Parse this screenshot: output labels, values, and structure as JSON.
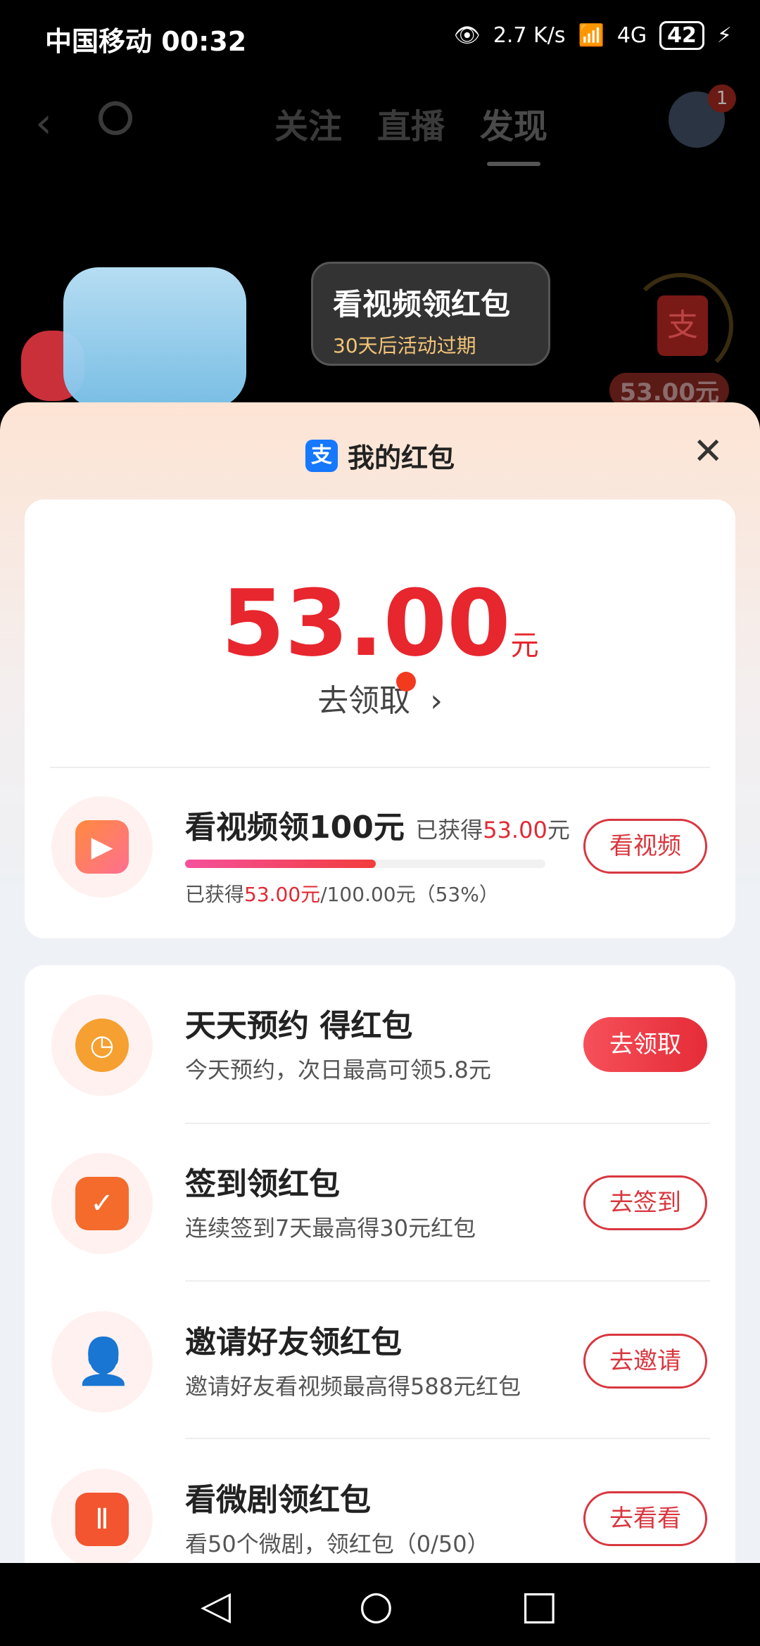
{
  "status": {
    "carrier": "中国移动",
    "time": "00:32",
    "speed": "2.7 K/s",
    "network": "4G",
    "battery": "42"
  },
  "nav": {
    "tabs": [
      "关注",
      "直播",
      "发现"
    ],
    "active": "发现",
    "badge": "1"
  },
  "banner": {
    "title": "看视频领红包",
    "subtitle": "30天后活动过期",
    "amount": "53.00元"
  },
  "sheet": {
    "title": "我的红包",
    "amount": "53.00",
    "unit": "元",
    "claim": "去领取"
  },
  "video": {
    "title": "看视频领100元",
    "earned_label": "已获得",
    "earned": "53.00",
    "earned_unit": "元",
    "progress_pre": "已获得",
    "progress_amt": "53.00元",
    "progress_post": "/100.00元（53%）",
    "progress": 0.53,
    "button": "看视频"
  },
  "tasks": [
    {
      "title": "天天预约 得红包",
      "desc": "今天预约，次日最高可领5.8元",
      "button": "去领取",
      "color": "#f5a030"
    },
    {
      "title": "签到领红包",
      "desc": "连续签到7天最高得30元红包",
      "button": "去签到",
      "color": "#f46b2b"
    },
    {
      "title": "邀请好友领红包",
      "desc": "邀请好友看视频最高得588元红包",
      "button": "去邀请",
      "color": "#f5822b"
    },
    {
      "title": "看微剧领红包",
      "desc": "看50个微剧，领红包（0/50）",
      "button": "去看看",
      "color": "#f2552f"
    }
  ]
}
